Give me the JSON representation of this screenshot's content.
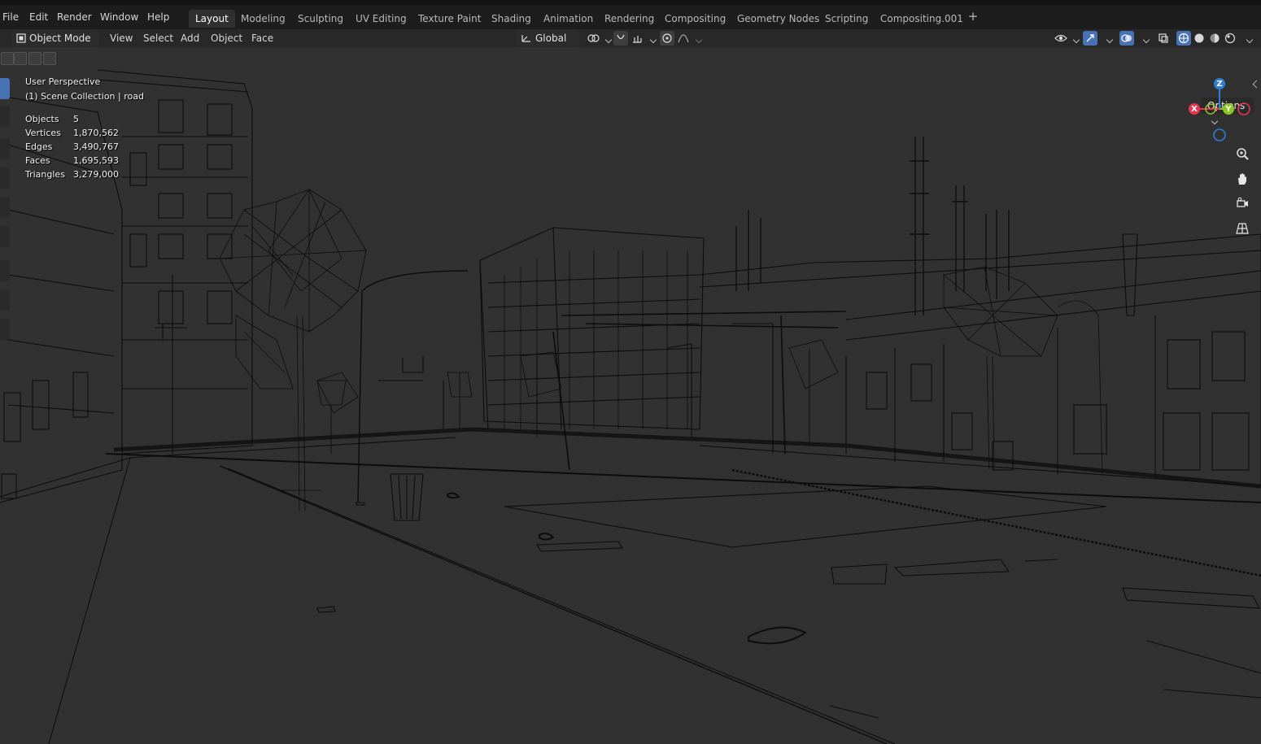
{
  "menu": [
    "File",
    "Edit",
    "Render",
    "Window",
    "Help"
  ],
  "workspaces": [
    {
      "label": "Layout",
      "active": true
    },
    {
      "label": "Modeling"
    },
    {
      "label": "Sculpting"
    },
    {
      "label": "UV Editing"
    },
    {
      "label": "Texture Paint"
    },
    {
      "label": "Shading"
    },
    {
      "label": "Animation"
    },
    {
      "label": "Rendering"
    },
    {
      "label": "Compositing"
    },
    {
      "label": "Geometry Nodes"
    },
    {
      "label": "Scripting"
    },
    {
      "label": "Compositing.001"
    }
  ],
  "add_workspace": "+",
  "header": {
    "mode": "Object Mode",
    "menus": [
      "View",
      "Select",
      "Add",
      "Object",
      "Face"
    ],
    "orientation": "Global",
    "options": "Options"
  },
  "overlay": {
    "view_name": "User Perspective",
    "collection": "(1) Scene Collection | road",
    "stats": [
      {
        "label": "Objects",
        "value": "5"
      },
      {
        "label": "Vertices",
        "value": "1,870,562"
      },
      {
        "label": "Edges",
        "value": "3,490,767"
      },
      {
        "label": "Faces",
        "value": "1,695,593"
      },
      {
        "label": "Triangles",
        "value": "3,279,000"
      }
    ]
  },
  "gizmo": {
    "x": "X",
    "y": "Y",
    "z": "Z",
    "x_color": "#e8344e",
    "y_color": "#8bc723",
    "z_color": "#2d7fd6"
  },
  "colors": {
    "accent": "#4772b3",
    "viewport_bg": "#313131",
    "topbar_bg": "#1d1d1d"
  }
}
